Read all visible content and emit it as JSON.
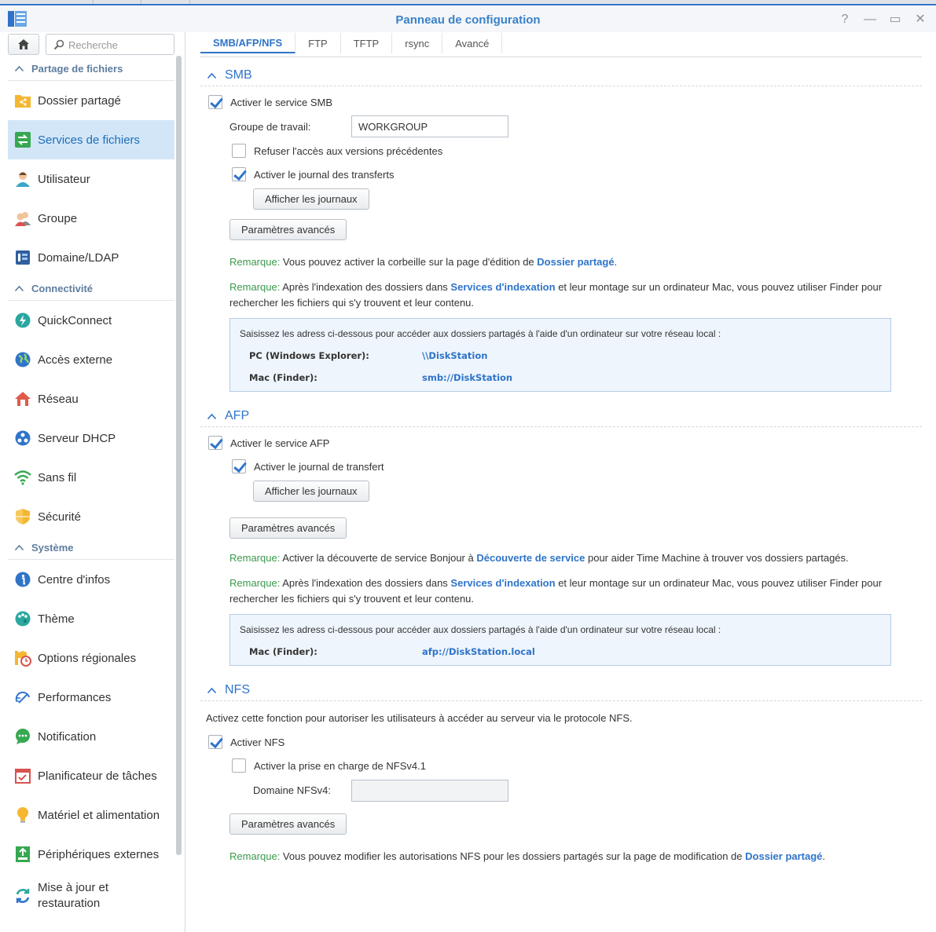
{
  "window": {
    "title": "Panneau de configuration",
    "help": "?",
    "minimize": "—",
    "maximize": "▭",
    "close": "✕"
  },
  "sidebar": {
    "search_placeholder": "Recherche",
    "sections": [
      {
        "title": "Partage de fichiers",
        "items": [
          "Dossier partagé",
          "Services de fichiers",
          "Utilisateur",
          "Groupe",
          "Domaine/LDAP"
        ]
      },
      {
        "title": "Connectivité",
        "items": [
          "QuickConnect",
          "Accès externe",
          "Réseau",
          "Serveur DHCP",
          "Sans fil",
          "Sécurité"
        ]
      },
      {
        "title": "Système",
        "items": [
          "Centre d'infos",
          "Thème",
          "Options régionales",
          "Performances",
          "Notification",
          "Planificateur de tâches",
          "Matériel et alimentation",
          "Périphériques externes",
          "Mise à jour et",
          "restauration"
        ]
      }
    ]
  },
  "tabs": [
    "SMB/AFP/NFS",
    "FTP",
    "TFTP",
    "rsync",
    "Avancé"
  ],
  "smb": {
    "title": "SMB",
    "enable": "Activer le service SMB",
    "workgroup_label": "Groupe de travail:",
    "workgroup_value": "WORKGROUP",
    "deny_prev": "Refuser l'accès aux versions précédentes",
    "transfer_log": "Activer le journal des transferts",
    "show_logs": "Afficher les journaux",
    "advanced": "Paramètres avancés",
    "remark": "Remarque:",
    "note1_a": " Vous pouvez activer la corbeille sur la page d'édition de ",
    "note1_link": "Dossier partagé",
    "note1_b": ".",
    "note2_a": " Après l'indexation des dossiers dans ",
    "note2_link": "Services d'indexation",
    "note2_b": " et leur montage sur un ordinateur Mac, vous pouvez utiliser Finder pour rechercher les fichiers qui s'y trouvent et leur contenu.",
    "box_intro": "Saisissez les adress ci-dessous pour accéder aux dossiers partagés à l'aide d'un ordinateur sur votre réseau local :",
    "pc_label": "PC (Windows Explorer):",
    "pc_value": "\\\\DiskStation",
    "mac_label": "Mac (Finder):",
    "mac_value": "smb://DiskStation"
  },
  "afp": {
    "title": "AFP",
    "enable": "Activer le service AFP",
    "transfer_log": "Activer le journal de transfert",
    "show_logs": "Afficher les journaux",
    "advanced": "Paramètres avancés",
    "remark": "Remarque:",
    "note1_a": " Activer la découverte de service Bonjour à ",
    "note1_link": "Découverte de service",
    "note1_b": " pour aider Time Machine à trouver vos dossiers partagés.",
    "note2_a": " Après l'indexation des dossiers dans ",
    "note2_link": "Services d'indexation",
    "note2_b": " et leur montage sur un ordinateur Mac, vous pouvez utiliser Finder pour rechercher les fichiers qui s'y trouvent et leur contenu.",
    "box_intro": "Saisissez les adress ci-dessous pour accéder aux dossiers partagés à l'aide d'un ordinateur sur votre réseau local :",
    "mac_label": "Mac (Finder):",
    "mac_value": "afp://DiskStation.local"
  },
  "nfs": {
    "title": "NFS",
    "desc": "Activez cette fonction pour autoriser les utilisateurs à accéder au serveur via le protocole NFS.",
    "enable": "Activer NFS",
    "nfs41": "Activer la prise en charge de NFSv4.1",
    "domain_label": "Domaine NFSv4:",
    "domain_value": "",
    "advanced": "Paramètres avancés",
    "remark": "Remarque:",
    "note_a": " Vous pouvez modifier les autorisations NFS pour les dossiers partagés sur la page de modification de ",
    "note_link": "Dossier partagé",
    "note_b": "."
  },
  "colors": {
    "accent": "#2f74c9",
    "remark": "#3a9a4b",
    "active_bg": "#d3e6f8"
  }
}
